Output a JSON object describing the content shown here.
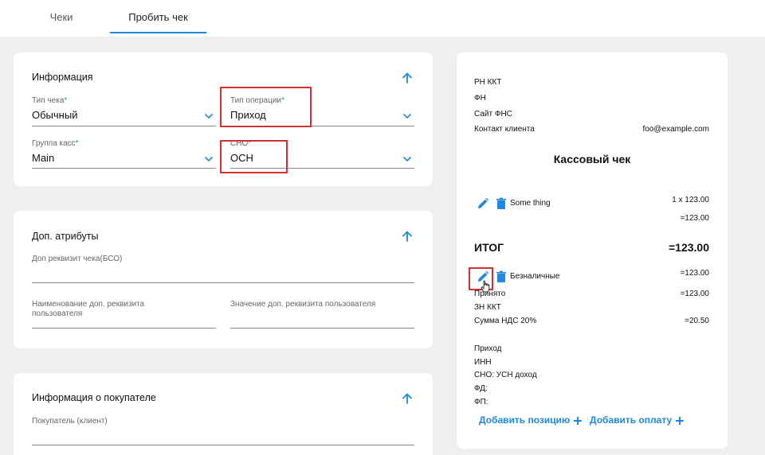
{
  "tabs": [
    {
      "label": "Чеки"
    },
    {
      "label": "Пробить чек"
    }
  ],
  "info": {
    "title": "Информация",
    "receipt_type": {
      "label": "Тип чека",
      "required": "*",
      "value": "Обычный"
    },
    "operation_type": {
      "label": "Тип операции",
      "required": "*",
      "value": "Приход"
    },
    "cash_group": {
      "label": "Группа касс",
      "required": "*",
      "value": "Main"
    },
    "tax_system": {
      "label": "СНО",
      "required": "*",
      "value": "ОСН"
    }
  },
  "extra": {
    "title": "Доп. атрибуты",
    "bso": {
      "label": "Доп реквизит чека(БСО)"
    },
    "user_attr_name": {
      "label": "Наименование доп. реквизита пользователя"
    },
    "user_attr_value": {
      "label": "Значение доп. реквизита пользователя"
    }
  },
  "buyer": {
    "title": "Информация о покупателе",
    "client": {
      "label": "Покупатель (клиент)"
    }
  },
  "receipt": {
    "rn_kkt": "РН ККТ",
    "fn": "ФН",
    "fns_site": "Сайт ФНС",
    "client_contact_label": "Контакт клиента",
    "client_contact_value": "foo@example.com",
    "title": "Кассовый чек",
    "item_name": "Some thing",
    "item_qty_price": "1 x 123.00",
    "item_sum": "=123.00",
    "total_label": "ИТОГ",
    "total_value": "=123.00",
    "payment_name": "Безналичные",
    "payment_value": "=123.00",
    "accepted_label": "Принято",
    "accepted_value": "=123.00",
    "zn_kkt": "ЗН ККТ",
    "vat_label": "Сумма НДС 20%",
    "vat_value": "=20.50",
    "operation": "Приход",
    "inn": "ИНН",
    "sno": "СНО: УСН доход",
    "fd": "ФД:",
    "fp": "ФП:",
    "add_position": "Добавить позицию",
    "add_payment": "Добавить оплату"
  },
  "colors": {
    "accent": "#1e88e5",
    "highlight": "#d32f2f"
  }
}
